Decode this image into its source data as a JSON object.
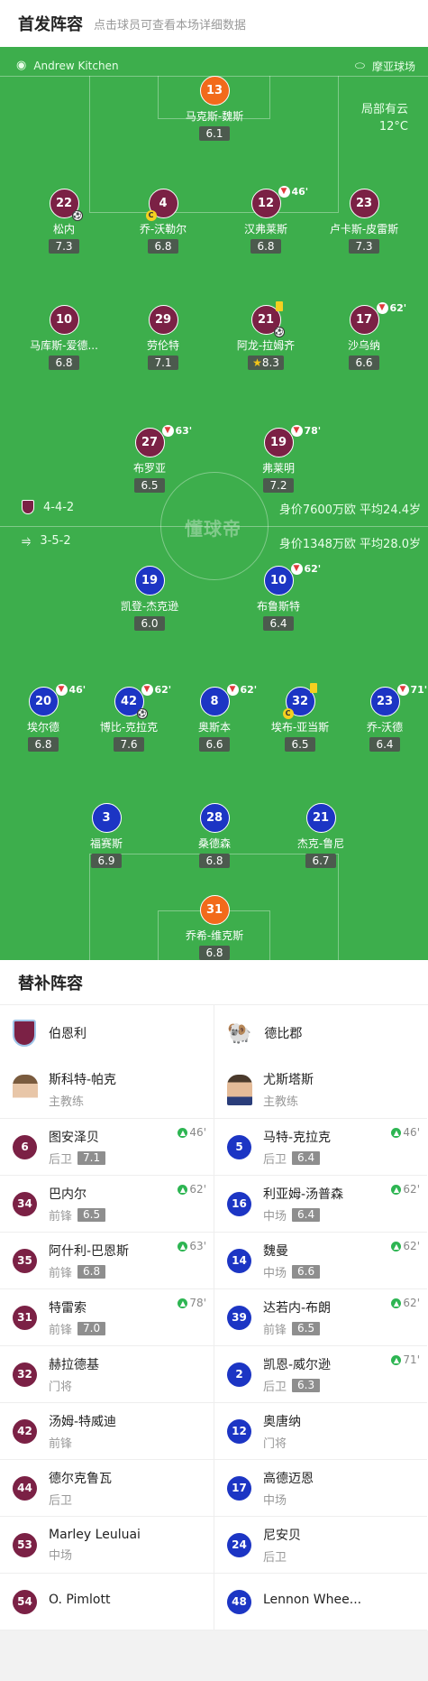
{
  "header": {
    "title": "首发阵容",
    "subtitle": "点击球员可查看本场详细数据"
  },
  "match": {
    "referee": "Andrew Kitchen",
    "venue": "摩亚球场",
    "weather": "局部有云",
    "temperature": "12°C",
    "watermark": "懂球帝"
  },
  "home": {
    "formation": "4-4-2",
    "value": "身价7600万欧 平均24.4岁",
    "color": "#7b2145",
    "players": [
      {
        "num": "13",
        "name": "马克斯-魏斯",
        "rating": "6.1"
      },
      {
        "num": "22",
        "name": "松内",
        "rating": "7.3"
      },
      {
        "num": "4",
        "name": "乔-沃勒尔",
        "rating": "6.8"
      },
      {
        "num": "12",
        "name": "汉弗莱斯",
        "rating": "6.8",
        "sub": "46'"
      },
      {
        "num": "23",
        "name": "卢卡斯-皮雷斯",
        "rating": "7.3"
      },
      {
        "num": "10",
        "name": "马库斯-爱德...",
        "rating": "6.8"
      },
      {
        "num": "29",
        "name": "劳伦特",
        "rating": "7.1"
      },
      {
        "num": "21",
        "name": "阿龙-拉姆齐",
        "rating": "8.3"
      },
      {
        "num": "17",
        "name": "沙乌纳",
        "rating": "6.6",
        "sub": "62'"
      },
      {
        "num": "27",
        "name": "布罗亚",
        "rating": "6.5",
        "sub": "63'"
      },
      {
        "num": "19",
        "name": "弗莱明",
        "rating": "7.2",
        "sub": "78'"
      }
    ]
  },
  "away": {
    "formation": "3-5-2",
    "value": "身价1348万欧 平均28.0岁",
    "color": "#1c35c4",
    "players": [
      {
        "num": "19",
        "name": "凯登-杰克逊",
        "rating": "6.0"
      },
      {
        "num": "10",
        "name": "布鲁斯特",
        "rating": "6.4",
        "sub": "62'"
      },
      {
        "num": "20",
        "name": "埃尔德",
        "rating": "6.8",
        "sub": "46'"
      },
      {
        "num": "42",
        "name": "博比-克拉克",
        "rating": "7.6",
        "sub": "62'"
      },
      {
        "num": "8",
        "name": "奥斯本",
        "rating": "6.6",
        "sub": "62'"
      },
      {
        "num": "32",
        "name": "埃布-亚当斯",
        "rating": "6.5"
      },
      {
        "num": "23",
        "name": "乔-沃德",
        "rating": "6.4",
        "sub": "71'"
      },
      {
        "num": "3",
        "name": "福赛斯",
        "rating": "6.9"
      },
      {
        "num": "28",
        "name": "桑德森",
        "rating": "6.8"
      },
      {
        "num": "21",
        "name": "杰克-鲁尼",
        "rating": "6.7"
      },
      {
        "num": "31",
        "name": "乔希-维克斯",
        "rating": "6.8"
      }
    ]
  },
  "bench": {
    "title": "替补阵容",
    "coach_role": "主教练",
    "home": {
      "team": "伯恩利",
      "coach": "斯科特-帕克",
      "subs": [
        {
          "num": "6",
          "name": "图安泽贝",
          "role": "后卫",
          "rating": "7.1",
          "in": "46'"
        },
        {
          "num": "34",
          "name": "巴内尔",
          "role": "前锋",
          "rating": "6.5",
          "in": "62'"
        },
        {
          "num": "35",
          "name": "阿什利-巴恩斯",
          "role": "前锋",
          "rating": "6.8",
          "in": "63'"
        },
        {
          "num": "31",
          "name": "特雷索",
          "role": "前锋",
          "rating": "7.0",
          "in": "78'"
        },
        {
          "num": "32",
          "name": "赫拉德基",
          "role": "门将"
        },
        {
          "num": "42",
          "name": "汤姆-特威迪",
          "role": "前锋"
        },
        {
          "num": "44",
          "name": "德尔克鲁瓦",
          "role": "后卫"
        },
        {
          "num": "53",
          "name": "Marley Leuluai",
          "role": "中场"
        },
        {
          "num": "54",
          "name": "O. Pimlott",
          "role": ""
        }
      ]
    },
    "away": {
      "team": "德比郡",
      "coach": "尤斯塔斯",
      "subs": [
        {
          "num": "5",
          "name": "马特-克拉克",
          "role": "后卫",
          "rating": "6.4",
          "in": "46'"
        },
        {
          "num": "16",
          "name": "利亚姆-汤普森",
          "role": "中场",
          "rating": "6.4",
          "in": "62'"
        },
        {
          "num": "14",
          "name": "魏曼",
          "role": "中场",
          "rating": "6.6",
          "in": "62'"
        },
        {
          "num": "39",
          "name": "达若内-布朗",
          "role": "前锋",
          "rating": "6.5",
          "in": "62'"
        },
        {
          "num": "2",
          "name": "凯恩-威尔逊",
          "role": "后卫",
          "rating": "6.3",
          "in": "71'"
        },
        {
          "num": "12",
          "name": "奥唐纳",
          "role": "门将"
        },
        {
          "num": "17",
          "name": "高德迈恩",
          "role": "中场"
        },
        {
          "num": "24",
          "name": "尼安贝",
          "role": "后卫"
        },
        {
          "num": "48",
          "name": "Lennon Whee...",
          "role": ""
        }
      ]
    }
  }
}
